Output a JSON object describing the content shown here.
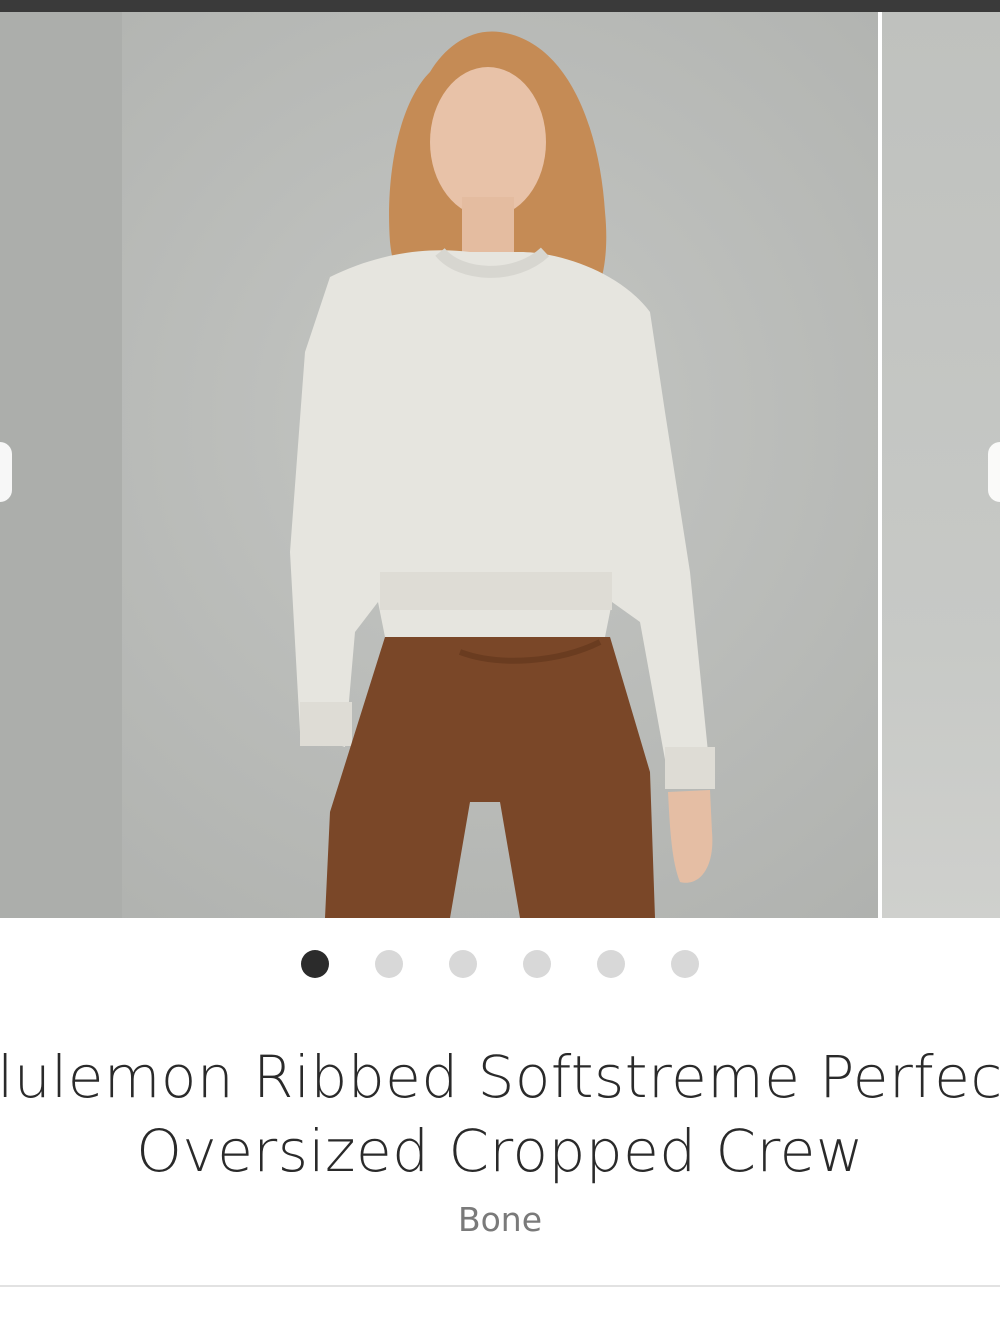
{
  "product": {
    "title_line1": "ululemon Ribbed Softstreme Perfectl",
    "title_line2": "Oversized Cropped Crew",
    "color_name": "Bone"
  },
  "carousel": {
    "slide_count": 6,
    "active_index": 0,
    "images": [
      {
        "alt": "photo-model-bone-sweatshirt",
        "main_bg": "#b8bab7"
      }
    ]
  },
  "colors": {
    "active_dot": "#2b2b2b",
    "inactive_dot": "#d8d8d8",
    "title_text": "#2a2a2a",
    "subtitle_text": "#7a7a7a"
  },
  "icons": {
    "prev": "chevron-left-icon",
    "next": "chevron-right-icon"
  }
}
